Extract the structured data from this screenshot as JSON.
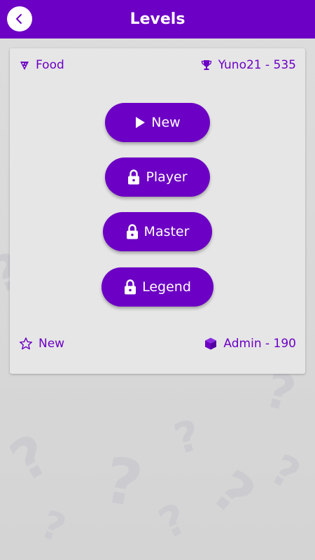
{
  "header": {
    "title": "Levels"
  },
  "card": {
    "category": "Food",
    "top_player": "Yuno21 - 535",
    "status": "New",
    "creator": "Admin - 190"
  },
  "levels": [
    {
      "label": "New",
      "icon": "play-icon",
      "locked": false
    },
    {
      "label": "Player",
      "icon": "lock-icon",
      "locked": true
    },
    {
      "label": "Master",
      "icon": "lock-icon",
      "locked": true
    },
    {
      "label": "Legend",
      "icon": "lock-icon",
      "locked": true
    }
  ],
  "colors": {
    "accent": "#6c00c4",
    "background": "#d8d8d8",
    "card": "#e6e6e6"
  }
}
